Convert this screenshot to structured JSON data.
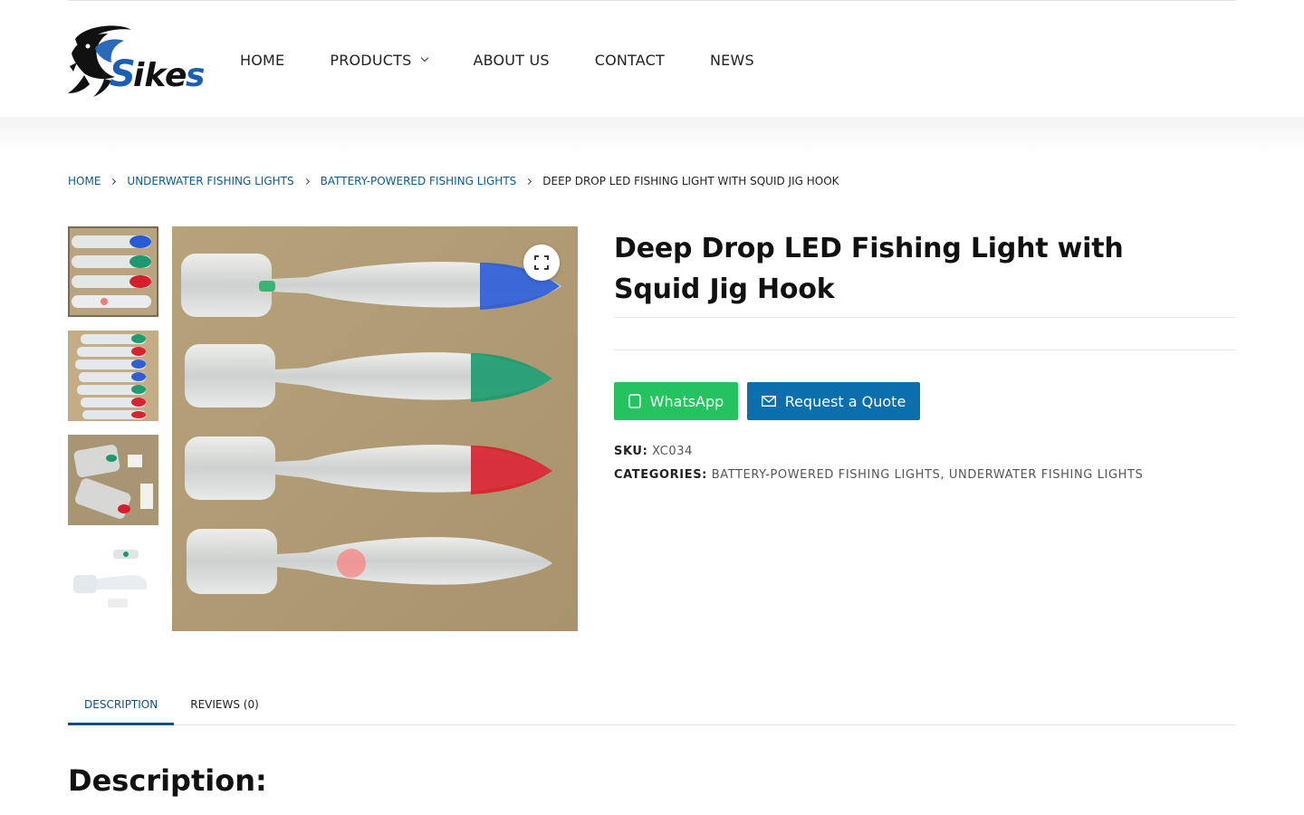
{
  "brand": {
    "logo_text": "Sikes",
    "logo_blue": "#1a5fb4"
  },
  "nav": {
    "home": "HOME",
    "products": "PRODUCTS",
    "about": "ABOUT US",
    "contact": "CONTACT",
    "news": "NEWS"
  },
  "breadcrumb": {
    "home": "HOME",
    "level1": "UNDERWATER FISHING LIGHTS",
    "level2": "BATTERY-POWERED FISHING LIGHTS",
    "current": "DEEP DROP LED FISHING LIGHT WITH SQUID JIG HOOK"
  },
  "gallery": {
    "thumbnail_count": 4,
    "selected_index": 0,
    "lure_colors": [
      "#2a5bd7",
      "#1a9a6e",
      "#d61f2c",
      "#e9e9ee"
    ]
  },
  "product": {
    "title": "Deep Drop LED Fishing Light with Squid Jig Hook",
    "whatsapp_label": "WhatsApp",
    "quote_label": "Request a Quote",
    "sku_label": "SKU:",
    "sku_value": "XC034",
    "categories_label": "CATEGORIES:",
    "category_1": "BATTERY-POWERED FISHING LIGHTS",
    "category_separator": ",",
    "category_2": "UNDERWATER FISHING LIGHTS"
  },
  "tabs": {
    "description": "DESCRIPTION",
    "reviews": "REVIEWS (0)",
    "active": "DESCRIPTION"
  },
  "description": {
    "heading": "Description:"
  },
  "colors": {
    "link_blue": "#0d5a8f",
    "whatsapp_green": "#25c35f",
    "quote_blue": "#0c6fad",
    "tab_active": "#0d4f86"
  }
}
